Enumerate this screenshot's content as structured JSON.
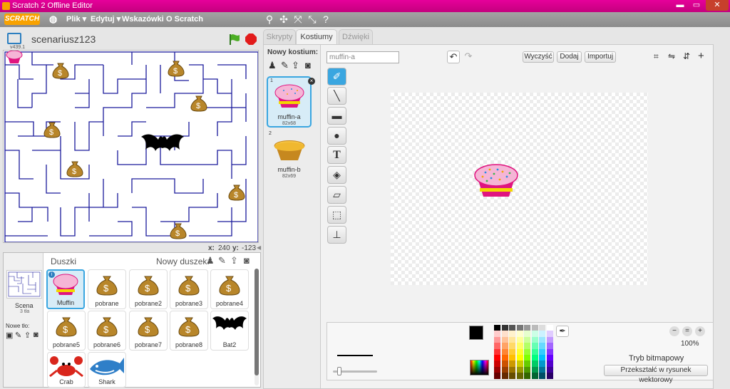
{
  "window": {
    "title": "Scratch 2 Offline Editor"
  },
  "menubar": {
    "logo": "SCRATCH",
    "items": [
      "Plik ▾",
      "Edytuj ▾",
      "Wskazówki",
      "O Scratch"
    ]
  },
  "stage": {
    "project_name": "scenariusz123",
    "version": "v439.1",
    "mouse_x_label": "x:",
    "mouse_x": "240",
    "mouse_y_label": "y:",
    "mouse_y": "-123"
  },
  "sprites_panel": {
    "title": "Duszki",
    "new_sprite_label": "Nowy duszek:",
    "scene_label": "Scena",
    "scene_sub": "3 tła",
    "new_backdrop_label": "Nowe tło:",
    "sprites": [
      "Muffin",
      "pobrane",
      "pobrane2",
      "pobrane3",
      "pobrane4",
      "pobrane5",
      "pobrane6",
      "pobrane7",
      "pobrane8",
      "Bat2",
      "Crab",
      "Shark"
    ]
  },
  "tabs": [
    "Skrypty",
    "Kostiumy",
    "Dźwięki"
  ],
  "costumes": {
    "new_label": "Nowy kostium:",
    "items": [
      {
        "num": "1",
        "name": "muffin-a",
        "size": "82x68"
      },
      {
        "num": "2",
        "name": "muffin-b",
        "size": "82x69"
      }
    ]
  },
  "paint": {
    "costume_name": "muffin-a",
    "clear": "Wyczyść",
    "add": "Dodaj",
    "import": "Importuj",
    "zoom": "100%",
    "mode": "Tryb bitmapowy",
    "convert": "Przekształć w rysunek wektorowy"
  },
  "palette": [
    "#000000",
    "#333333",
    "#555555",
    "#777777",
    "#999999",
    "#bbbbbb",
    "#dddddd",
    "#ffffff",
    "#ffcccc",
    "#ffe0cc",
    "#fff2cc",
    "#ffffcc",
    "#e6ffcc",
    "#ccffe6",
    "#ccf2ff",
    "#e0ccff",
    "#ff9999",
    "#ffc299",
    "#ffe699",
    "#ffff99",
    "#ccff99",
    "#99ffcc",
    "#99e6ff",
    "#c299ff",
    "#ff6666",
    "#ffa366",
    "#ffd966",
    "#ffff66",
    "#b3ff66",
    "#66ffb3",
    "#66d9ff",
    "#a366ff",
    "#ff3333",
    "#ff8533",
    "#ffcc33",
    "#ffff33",
    "#99ff33",
    "#33ff99",
    "#33ccff",
    "#8533ff",
    "#ff0000",
    "#ff6600",
    "#ffbf00",
    "#ffff00",
    "#80ff00",
    "#00ff80",
    "#00bfff",
    "#6600ff",
    "#cc0000",
    "#cc5200",
    "#cc9900",
    "#cccc00",
    "#66cc00",
    "#00cc66",
    "#0099cc",
    "#5200cc",
    "#990000",
    "#993d00",
    "#997300",
    "#999900",
    "#4d9900",
    "#00994d",
    "#007399",
    "#3d0099",
    "#660000",
    "#662900",
    "#664d00",
    "#666600",
    "#336600",
    "#006633",
    "#004d66",
    "#290066"
  ]
}
